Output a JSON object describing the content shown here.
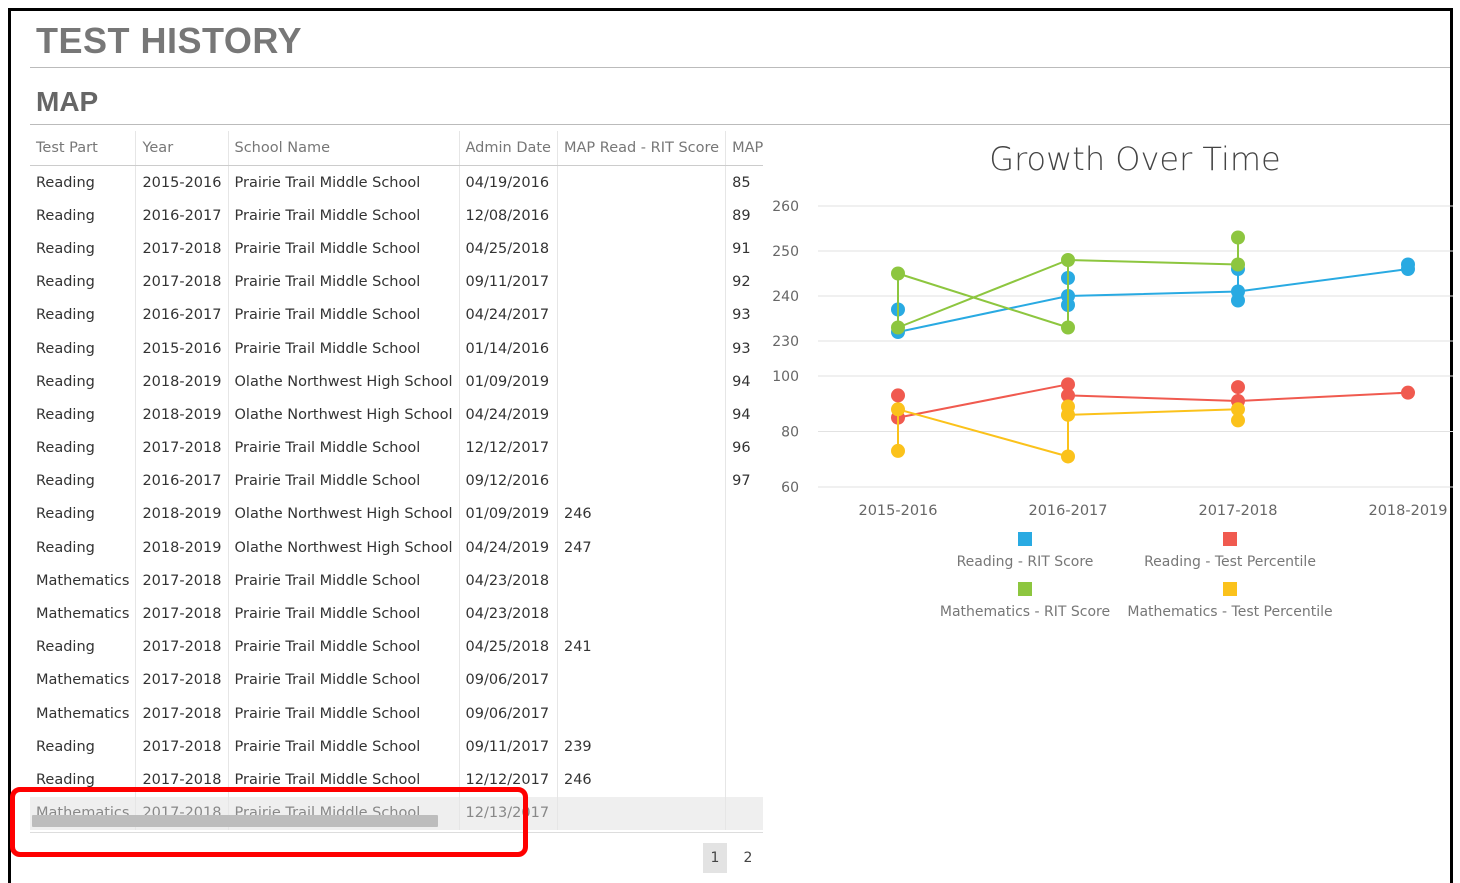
{
  "page_title": "TEST HISTORY",
  "section_title": "MAP",
  "table": {
    "columns": [
      "Test Part",
      "Year",
      "School Name",
      "Admin Date",
      "MAP Read - RIT Score",
      "MAP"
    ],
    "rows": [
      [
        "Reading",
        "2015-2016",
        "Prairie Trail Middle School",
        "04/19/2016",
        "",
        "85"
      ],
      [
        "Reading",
        "2016-2017",
        "Prairie Trail Middle School",
        "12/08/2016",
        "",
        "89"
      ],
      [
        "Reading",
        "2017-2018",
        "Prairie Trail Middle School",
        "04/25/2018",
        "",
        "91"
      ],
      [
        "Reading",
        "2017-2018",
        "Prairie Trail Middle School",
        "09/11/2017",
        "",
        "92"
      ],
      [
        "Reading",
        "2016-2017",
        "Prairie Trail Middle School",
        "04/24/2017",
        "",
        "93"
      ],
      [
        "Reading",
        "2015-2016",
        "Prairie Trail Middle School",
        "01/14/2016",
        "",
        "93"
      ],
      [
        "Reading",
        "2018-2019",
        "Olathe Northwest High School",
        "01/09/2019",
        "",
        "94"
      ],
      [
        "Reading",
        "2018-2019",
        "Olathe Northwest High School",
        "04/24/2019",
        "",
        "94"
      ],
      [
        "Reading",
        "2017-2018",
        "Prairie Trail Middle School",
        "12/12/2017",
        "",
        "96"
      ],
      [
        "Reading",
        "2016-2017",
        "Prairie Trail Middle School",
        "09/12/2016",
        "",
        "97"
      ],
      [
        "Reading",
        "2018-2019",
        "Olathe Northwest High School",
        "01/09/2019",
        "246",
        ""
      ],
      [
        "Reading",
        "2018-2019",
        "Olathe Northwest High School",
        "04/24/2019",
        "247",
        ""
      ],
      [
        "Mathematics",
        "2017-2018",
        "Prairie Trail Middle School",
        "04/23/2018",
        "",
        ""
      ],
      [
        "Mathematics",
        "2017-2018",
        "Prairie Trail Middle School",
        "04/23/2018",
        "",
        ""
      ],
      [
        "Reading",
        "2017-2018",
        "Prairie Trail Middle School",
        "04/25/2018",
        "241",
        ""
      ],
      [
        "Mathematics",
        "2017-2018",
        "Prairie Trail Middle School",
        "09/06/2017",
        "",
        ""
      ],
      [
        "Mathematics",
        "2017-2018",
        "Prairie Trail Middle School",
        "09/06/2017",
        "",
        ""
      ],
      [
        "Reading",
        "2017-2018",
        "Prairie Trail Middle School",
        "09/11/2017",
        "239",
        ""
      ],
      [
        "Reading",
        "2017-2018",
        "Prairie Trail Middle School",
        "12/12/2017",
        "246",
        ""
      ],
      [
        "Mathematics",
        "2017-2018",
        "Prairie Trail Middle School",
        "12/13/2017",
        "",
        ""
      ]
    ]
  },
  "pagination": {
    "pages": [
      "1",
      "2"
    ],
    "current": "1"
  },
  "colors": {
    "reading_rit": "#29aae2",
    "reading_pct": "#f05a4f",
    "math_rit": "#8dc63f",
    "math_pct": "#fbc21b",
    "highlight": "#ff0000"
  },
  "chart_data": {
    "type": "line",
    "title": "Growth Over Time",
    "categories": [
      "2015-2016",
      "2016-2017",
      "2017-2018",
      "2018-2019"
    ],
    "panels": [
      {
        "yticks": [
          "230",
          "240",
          "250",
          "260"
        ],
        "ylim": [
          226,
          262
        ],
        "series": [
          {
            "name": "Reading - RIT Score",
            "color": "#29aae2",
            "points": {
              "2015-2016": [
                232,
                237
              ],
              "2016-2017": [
                238,
                240,
                244
              ],
              "2017-2018": [
                239,
                241,
                246
              ],
              "2018-2019": [
                246,
                247
              ]
            },
            "line": [
              232,
              240,
              241,
              246
            ]
          },
          {
            "name": "Mathematics - RIT Score",
            "color": "#8dc63f",
            "points": {
              "2015-2016": [
                233,
                245
              ],
              "2016-2017": [
                233,
                248
              ],
              "2017-2018": [
                247,
                253
              ]
            },
            "line": [
              245,
              233,
              null,
              null
            ],
            "line2": [
              233,
              248,
              247,
              null
            ]
          }
        ]
      },
      {
        "yticks": [
          "60",
          "80",
          "100"
        ],
        "ylim": [
          60,
          100
        ],
        "series": [
          {
            "name": "Reading - Test Percentile",
            "color": "#f05a4f",
            "points": {
              "2015-2016": [
                85,
                93
              ],
              "2016-2017": [
                93,
                97
              ],
              "2017-2018": [
                91,
                96
              ],
              "2018-2019": [
                94
              ]
            },
            "line": [
              85,
              97,
              null,
              null
            ],
            "line2": [
              null,
              93,
              91,
              94
            ]
          },
          {
            "name": "Mathematics - Test Percentile",
            "color": "#fbc21b",
            "points": {
              "2015-2016": [
                73,
                88
              ],
              "2016-2017": [
                71,
                86,
                89
              ],
              "2017-2018": [
                84,
                88
              ]
            },
            "line": [
              88,
              71,
              null,
              null
            ],
            "line2": [
              null,
              86,
              88,
              null
            ]
          }
        ]
      }
    ]
  }
}
